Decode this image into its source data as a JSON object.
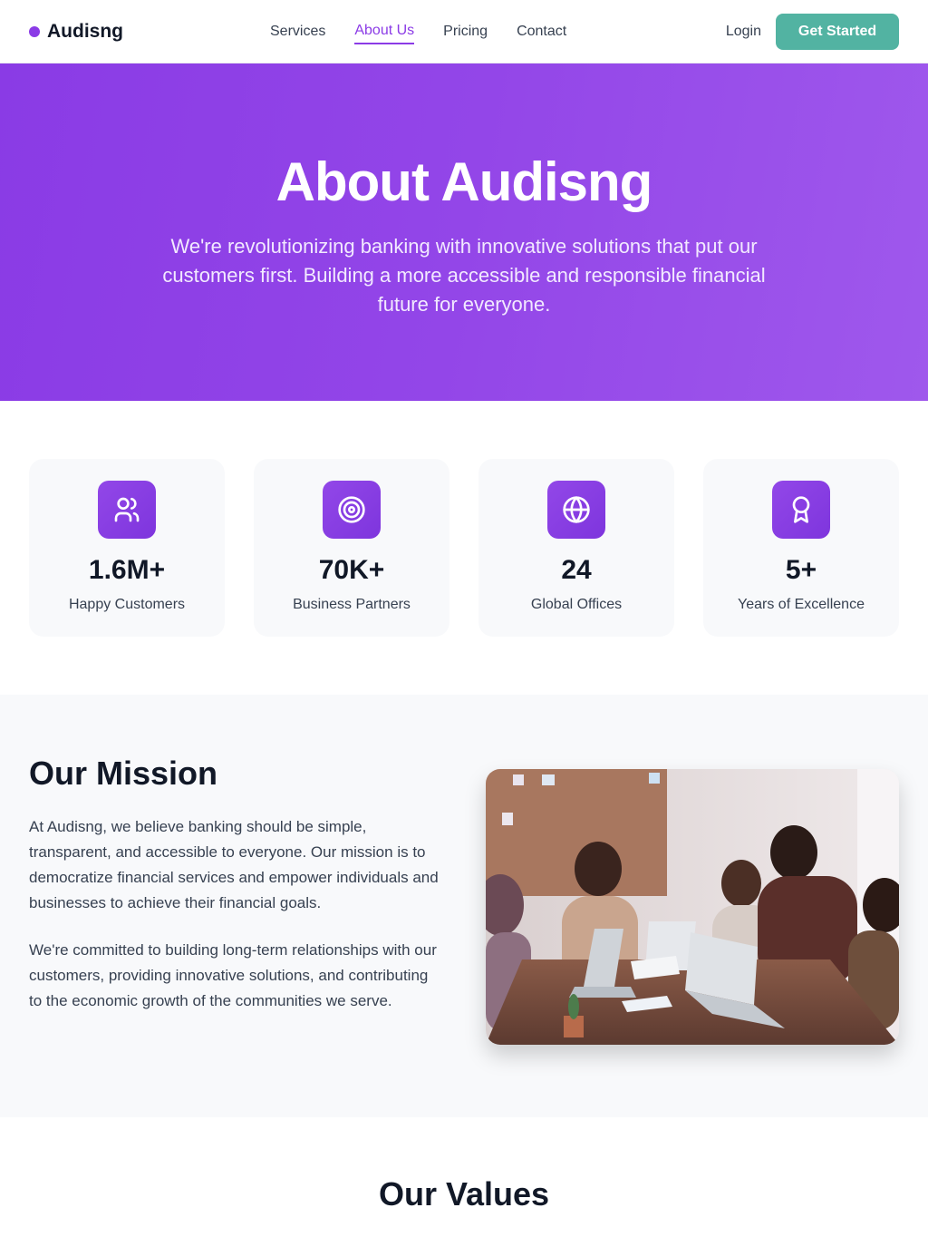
{
  "nav": {
    "brand": "Audisng",
    "links": [
      "Services",
      "About Us",
      "Pricing",
      "Contact"
    ],
    "login": "Login",
    "cta": "Get Started"
  },
  "hero": {
    "title": "About Audisng",
    "subtitle": "We're revolutionizing banking with innovative solutions that put our customers first. Building a more accessible and responsible financial future for everyone."
  },
  "stats": [
    {
      "icon": "users-icon",
      "value": "1.6M+",
      "label": "Happy Customers"
    },
    {
      "icon": "target-icon",
      "value": "70K+",
      "label": "Business Partners"
    },
    {
      "icon": "globe-icon",
      "value": "24",
      "label": "Global Offices"
    },
    {
      "icon": "award-icon",
      "value": "5+",
      "label": "Years of Excellence"
    }
  ],
  "mission": {
    "title": "Our Mission",
    "paragraphs": [
      "At Audisng, we believe banking should be simple, transparent, and accessible to everyone. Our mission is to democratize financial services and empower individuals and businesses to achieve their financial goals.",
      "We're committed to building long-term relationships with our customers, providing innovative solutions, and contributing to the economic growth of the communities we serve."
    ]
  },
  "values": {
    "title": "Our Values"
  },
  "colors": {
    "accent": "#8b3be6",
    "cta": "#52b3a2",
    "text": "#111827",
    "muted": "#374151"
  }
}
